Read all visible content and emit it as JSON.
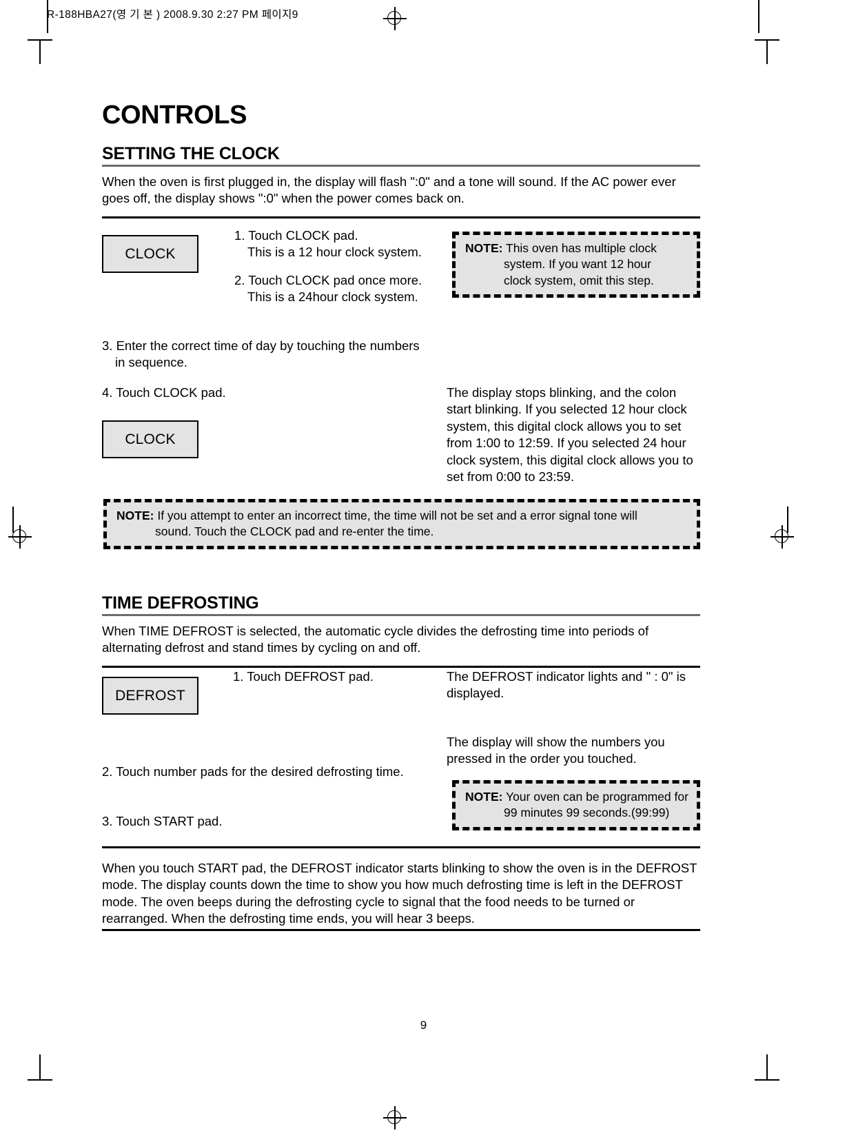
{
  "page": {
    "slug": "R-188HBA27(영 기 본 )  2008.9.30 2:27 PM  페이지9",
    "number": "9",
    "chapter_title": "CONTROLS"
  },
  "sections": [
    {
      "id": "setting-the-clock",
      "title": "SETTING THE CLOCK",
      "intro": "When the oven is first plugged in, the display will flash \":0\" and a tone will sound. If the AC power ever goes off, the display shows \":0\" when the power  comes back on.",
      "pad_1_label": "CLOCK",
      "pad_2_label": "CLOCK",
      "step_1_line_1": "1. Touch CLOCK pad.",
      "step_1_line_2": "This is a 12 hour clock system.",
      "step_2_line_1": "2. Touch CLOCK pad once more.",
      "step_2_line_2": "This is a 24hour clock system.",
      "step_3_line_1": "3. Enter the correct time of day by touching the numbers",
      "step_3_line_2": "in sequence.",
      "step_4": "4. Touch CLOCK pad.",
      "result_text": "The display stops blinking, and the colon start blinking. If you selected 12 hour clock system, this digital clock allows you to set from 1:00 to 12:59. If you selected 24 hour clock system, this digital clock allows you to set from 0:00 to 23:59.",
      "note_1": {
        "label": "NOTE:",
        "line_1": "This oven has multiple clock",
        "line_2": "system. If you want 12 hour",
        "line_3": "clock system, omit this step."
      },
      "note_2": {
        "label": "NOTE:",
        "line_1": "If you attempt to enter an incorrect time, the time will not be set and a error signal tone will",
        "line_2": "sound. Touch the CLOCK pad and re-enter the time."
      }
    },
    {
      "id": "time-defrosting",
      "title": "TIME DEFROSTING",
      "intro": "When TIME DEFROST is selected, the automatic cycle divides the defrosting time into periods of alternating defrost and stand times by cycling on and off.",
      "pad_label": "DEFROST",
      "step_1": "1. Touch DEFROST pad.",
      "step_2": "2. Touch number pads for the desired defrosting time.",
      "step_3": "3. Touch START pad.",
      "result_1": "The DEFROST indicator lights and \" : 0\" is displayed.",
      "result_2": "The display will show the numbers you pressed in the order you touched.",
      "note_3": {
        "label": "NOTE:",
        "line_1": "Your oven can be programmed for",
        "line_2": "99 minutes 99 seconds.(99:99)"
      },
      "closing": "When you touch START pad, the DEFROST indicator starts blinking to show the oven is in the DEFROST mode. The display counts down the time to show you how much defrosting time is left in the DEFROST mode. The oven beeps during the defrosting cycle to signal that the food needs to be turned or rearranged. When the defrosting time ends, you will hear 3 beeps."
    }
  ],
  "colors": {
    "pad_fill": "#e3e3e3",
    "note_fill": "#e3e3e3",
    "rule_gray": "#6b6b6b",
    "ink": "#000000"
  }
}
